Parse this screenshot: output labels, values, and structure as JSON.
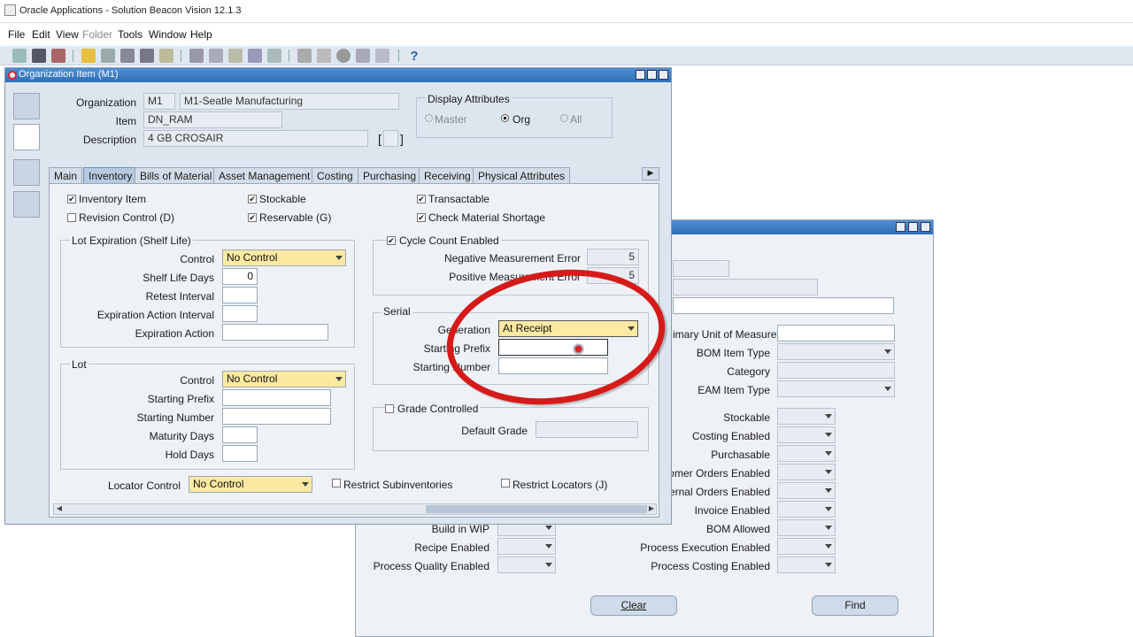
{
  "app": {
    "title": "Oracle Applications - Solution Beacon Vision 12.1.3"
  },
  "menu": [
    "File",
    "Edit",
    "View",
    "Folder",
    "Tools",
    "Window",
    "Help"
  ],
  "window": {
    "title": "Organization Item (M1)"
  },
  "header": {
    "org_label": "Organization",
    "org_code": "M1",
    "org_name": "M1-Seatle Manufacturing",
    "item_label": "Item",
    "item": "DN_RAM",
    "desc_label": "Description",
    "desc": "4 GB CROSAIR",
    "desc_bracket": "[",
    "desc_bracket_close": "]",
    "display_attrs": {
      "title": "Display Attributes",
      "master": "Master",
      "org": "Org",
      "all": "All",
      "selected": "Org"
    }
  },
  "tabs": [
    "Main",
    "Inventory",
    "Bills of Material",
    "Asset Management",
    "Costing",
    "Purchasing",
    "Receiving",
    "Physical Attributes"
  ],
  "active_tab": "Inventory",
  "inventory": {
    "inventory_item": "Inventory Item",
    "stockable": "Stockable",
    "transactable": "Transactable",
    "revision_control": "Revision Control (D)",
    "reservable": "Reservable (G)",
    "check_shortage": "Check Material Shortage",
    "lot_exp": {
      "title": "Lot Expiration (Shelf Life)",
      "control_label": "Control",
      "control": "No Control",
      "shelf_label": "Shelf Life Days",
      "shelf": "0",
      "retest_label": "Retest Interval",
      "exp_int_label": "Expiration Action Interval",
      "exp_act_label": "Expiration Action"
    },
    "lot": {
      "title": "Lot",
      "control_label": "Control",
      "control": "No Control",
      "prefix_label": "Starting Prefix",
      "number_label": "Starting Number",
      "maturity_label": "Maturity Days",
      "hold_label": "Hold Days"
    },
    "cycle": {
      "title": "Cycle Count Enabled",
      "neg_label": "Negative Measurement Error",
      "neg": "5",
      "pos_label": "Positive Measurement Error",
      "pos": "5"
    },
    "serial": {
      "title": "Serial",
      "gen_label": "Generation",
      "gen": "At Receipt",
      "prefix_label": "Starting Prefix",
      "number_label": "Starting Number"
    },
    "grade": {
      "title": "Grade Controlled",
      "default_label": "Default Grade"
    },
    "locator_label": "Locator Control",
    "locator": "No Control",
    "restrict_sub": "Restrict Subinventories",
    "restrict_loc": "Restrict Locators (J)"
  },
  "find": {
    "right_labels": [
      "imary Unit of Measure",
      "BOM Item Type",
      "Category",
      "EAM Item Type",
      "Stockable",
      "Costing Enabled",
      "Purchasable",
      "tomer Orders Enabled",
      "ternal Orders Enabled",
      "Invoice Enabled",
      "BOM Allowed",
      "Process Execution Enabled",
      "Process Costing Enabled"
    ],
    "left_labels": [
      "Build in WIP",
      "Recipe Enabled",
      "Process Quality Enabled"
    ],
    "clear": "Clear",
    "find": "Find"
  },
  "colors": {
    "annotation": "#d61a1a",
    "required": "#fde9a2",
    "title": "#2d6fb7"
  }
}
